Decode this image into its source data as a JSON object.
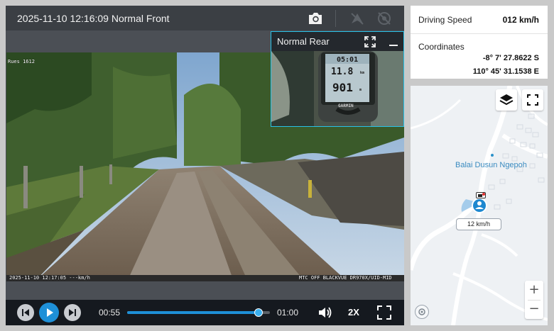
{
  "video": {
    "title": "2025-11-10 12:16:09 Normal Front",
    "osd_top_left": "Rues 1612",
    "osd_bottom_left": "2025-11-10 12:17:05 ---km/h",
    "osd_bottom_right": "MTC OFF BLACKVUE DR970X/UID-MID",
    "rear": {
      "title": "Normal Rear",
      "gps_time": "05:01",
      "gps_distance": "11.8",
      "gps_distance_unit": "km",
      "gps_altitude": "901",
      "gps_altitude_unit": "m",
      "gps_brand": "GARMIN"
    }
  },
  "controls": {
    "time_current": "00:55",
    "time_total": "01:00",
    "progress": 0.92,
    "speed": "2X"
  },
  "info": {
    "speed_label": "Driving Speed",
    "speed_value": "012 km/h",
    "coords_label": "Coordinates",
    "latitude": "-8° 7' 27.8622 S",
    "longitude": "110° 45' 31.1538 E"
  },
  "map": {
    "poi_label": "Balai Dusun Ngepoh",
    "speed_tag": "12 km/h",
    "zoom_in": "+",
    "zoom_out": "−"
  },
  "colors": {
    "accent": "#1e90d8",
    "inset_border": "#28c2e8"
  },
  "icons": [
    "camera-icon",
    "no-gps-icon",
    "no-signal-icon",
    "expand-icon",
    "minimize-icon",
    "skip-back-icon",
    "play-icon",
    "skip-forward-icon",
    "volume-icon",
    "fullscreen-icon",
    "layers-icon",
    "map-fullscreen-icon",
    "car-marker-icon",
    "map-logo-icon"
  ]
}
